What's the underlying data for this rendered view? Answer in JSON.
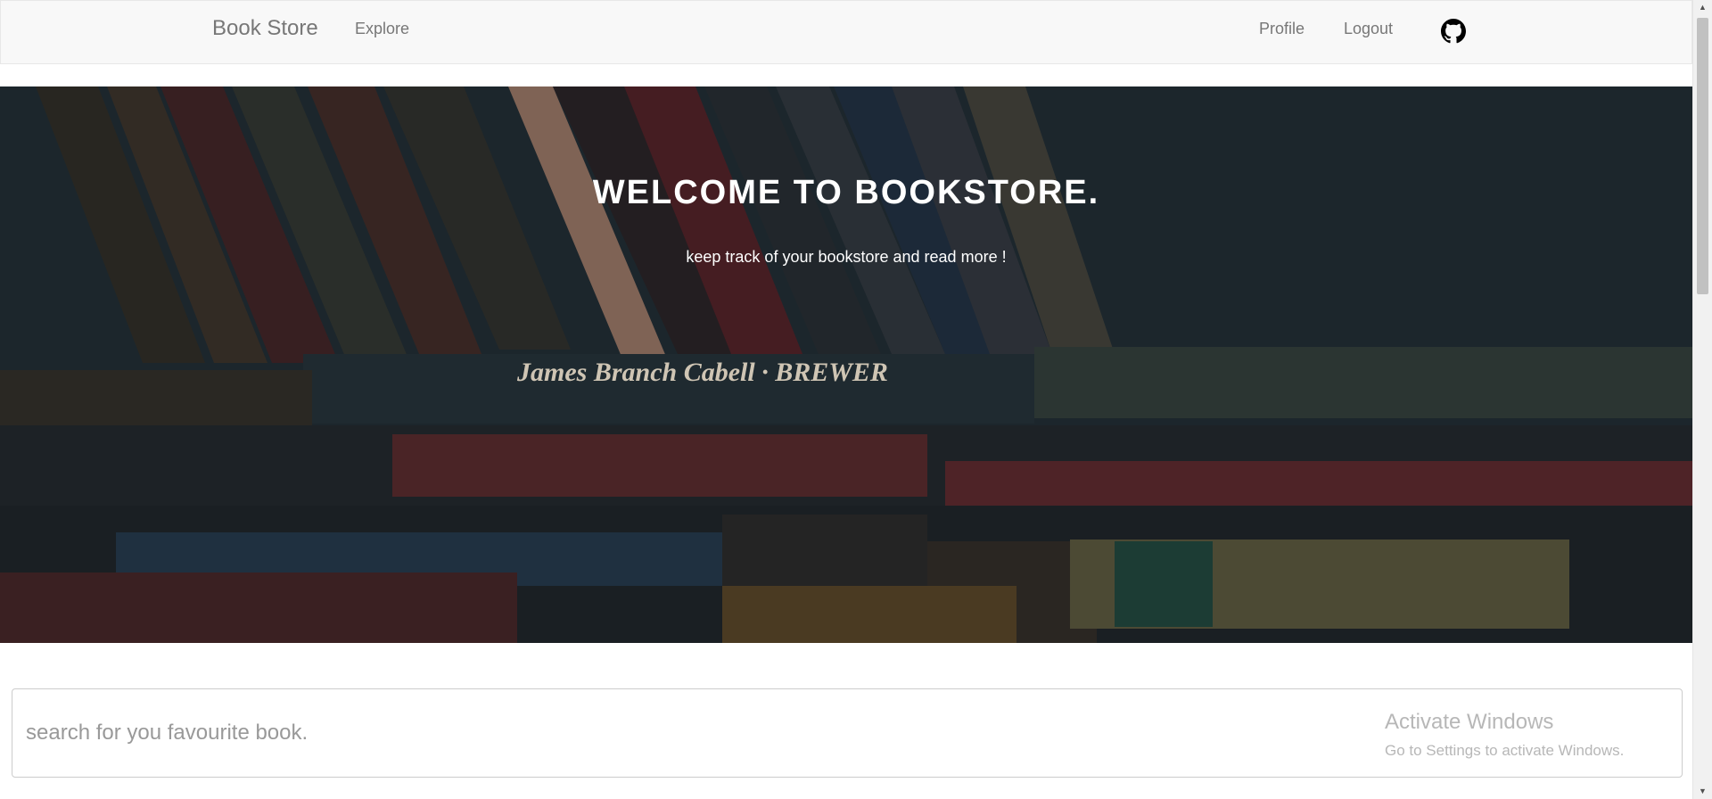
{
  "navbar": {
    "brand": "Book Store",
    "explore": "Explore",
    "profile": "Profile",
    "logout": "Logout",
    "github_icon": "github-icon"
  },
  "hero": {
    "title": "WELCOME TO BOOKSTORE.",
    "subtitle": "keep track of your bookstore and read more !",
    "book_spine_text": "James Branch Cabell · BREWER"
  },
  "search": {
    "placeholder": "search for you favourite book.",
    "value": ""
  },
  "watermark": {
    "title": "Activate Windows",
    "subtitle": "Go to Settings to activate Windows."
  },
  "colors": {
    "navbar_bg": "#f8f8f8",
    "nav_text": "#777777",
    "hero_overlay": "#1c262d",
    "hero_text": "#ffffff"
  }
}
